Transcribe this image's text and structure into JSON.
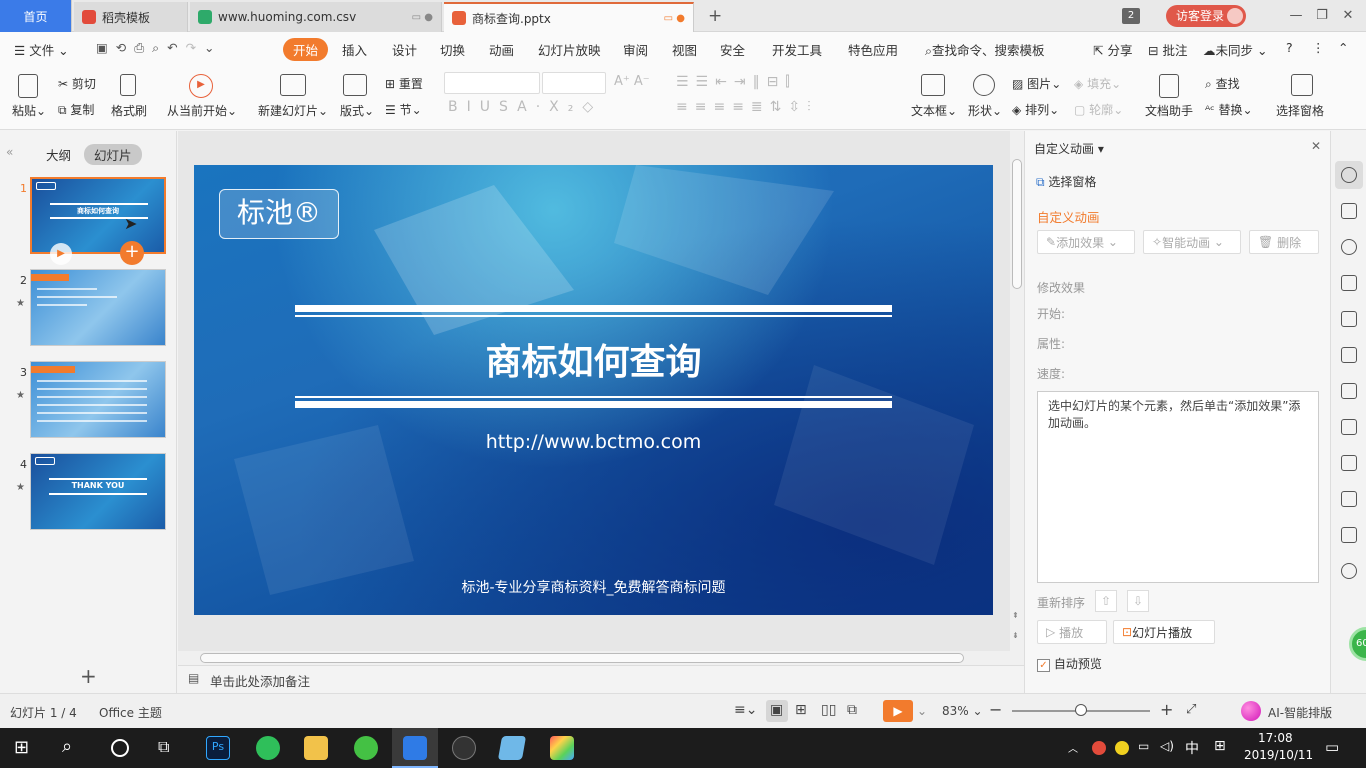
{
  "tabs": {
    "home": "首页",
    "template": "稻壳模板",
    "csv": "www.huoming.com.csv",
    "pptx": "商标查询.pptx",
    "new_tab": "+",
    "badge_count": "2",
    "login": "访客登录"
  },
  "menu": {
    "file": "文件",
    "items": [
      "开始",
      "插入",
      "设计",
      "切换",
      "动画",
      "幻灯片放映",
      "审阅",
      "视图",
      "安全",
      "开发工具",
      "特色应用"
    ],
    "search": "查找命令、搜索模板",
    "share": "分享",
    "comment": "批注",
    "sync": "未同步",
    "help": "?"
  },
  "ribbon": {
    "paste": "粘贴",
    "cut": "剪切",
    "copy": "复制",
    "format_painter": "格式刷",
    "from_current": "从当前开始",
    "new_slide": "新建幻灯片",
    "layout": "版式",
    "reset": "重置",
    "section": "节",
    "text_box": "文本框",
    "shape": "形状",
    "picture": "图片",
    "fill": "填充",
    "arrange": "排列",
    "outline": "轮廓",
    "doc_helper": "文档助手",
    "find": "查找",
    "replace": "替换",
    "select_pane": "选择窗格"
  },
  "left": {
    "outline_tab": "大纲",
    "slides_tab": "幻灯片",
    "numbers": [
      "1",
      "2",
      "3",
      "4"
    ],
    "thumb1_title": "商标如何查询",
    "thumb4_title": "THANK YOU",
    "add": "+"
  },
  "slide": {
    "logo": "标池®",
    "title": "商标如何查询",
    "url": "http://www.bctmo.com",
    "footer": "标池-专业分享商标资料_免费解答商标问题"
  },
  "notes": {
    "placeholder": "单击此处添加备注"
  },
  "right": {
    "panel_title": "自定义动画",
    "select_pane": "选择窗格",
    "section_title": "自定义动画",
    "add_effect": "添加效果",
    "smart_anim": "智能动画",
    "delete": "删除",
    "modify": "修改效果",
    "start": "开始:",
    "property": "属性:",
    "speed": "速度:",
    "hint": "选中幻灯片的某个元素，然后单击“添加效果”添加动画。",
    "reorder": "重新排序",
    "play": "播放",
    "slideshow": "幻灯片播放",
    "autopreview": "自动预览"
  },
  "status": {
    "slide_pos": "幻灯片 1 / 4",
    "theme": "Office 主题",
    "zoom": "83%",
    "zoom_value": 0.5,
    "ai": "AI-智能排版"
  },
  "taskbar": {
    "time": "17:08",
    "date": "2019/10/11",
    "ime": "中",
    "ps": "Ps"
  },
  "colors": {
    "accent": "#f27b2d",
    "home_tab": "#3b7be8",
    "login": "#e0584a"
  }
}
